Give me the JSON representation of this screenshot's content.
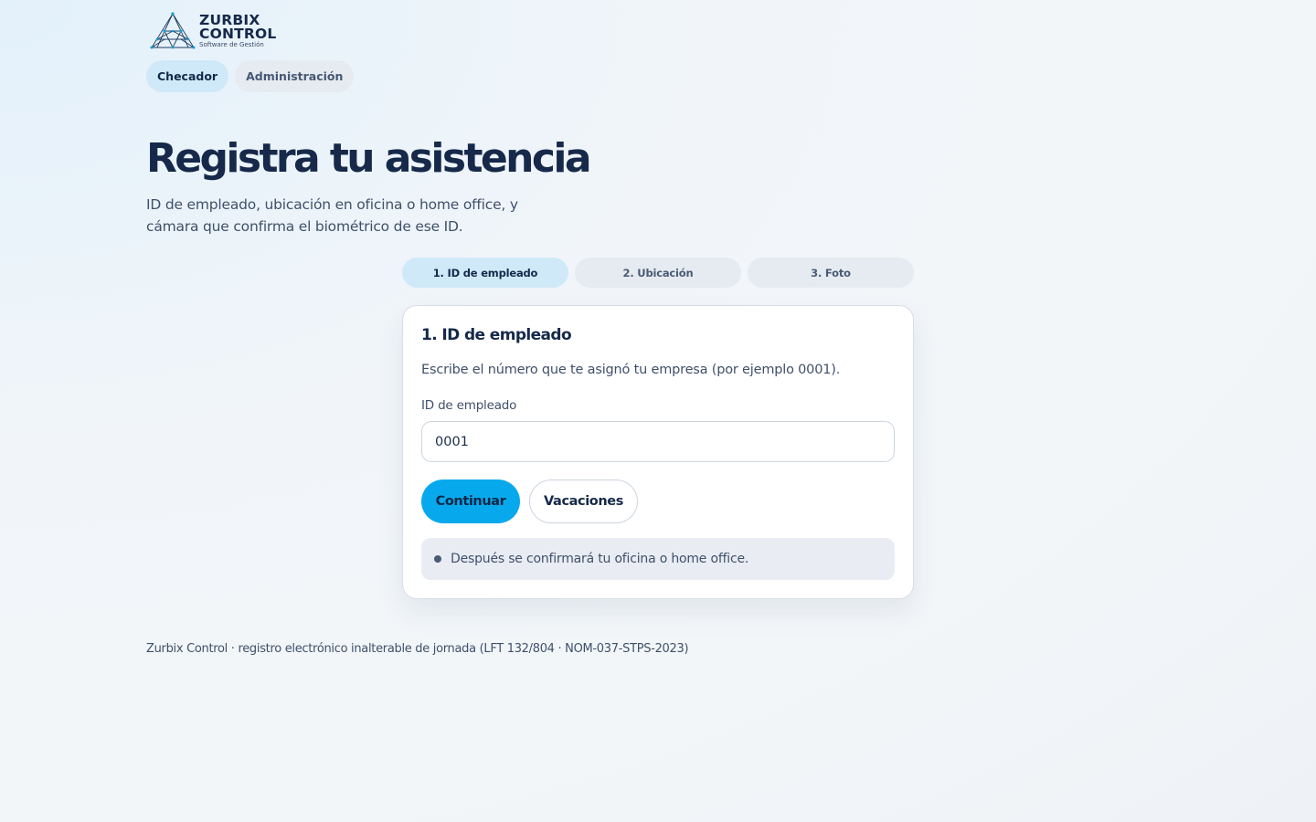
{
  "brand": {
    "name_line1": "ZURBIX",
    "name_line2": "CONTROL",
    "tagline": "Software de Gestión",
    "logo_icon": "network-pyramid-icon"
  },
  "nav": {
    "tabs": [
      {
        "label": "Checador",
        "active": true
      },
      {
        "label": "Administración",
        "active": false
      }
    ]
  },
  "hero": {
    "title": "Registra tu asistencia",
    "subtitle": "ID de empleado, ubicación en oficina o home office, y cámara que confirma el biométrico de ese ID."
  },
  "steps": [
    {
      "label": "1. ID de empleado",
      "active": true
    },
    {
      "label": "2. Ubicación",
      "active": false
    },
    {
      "label": "3. Foto",
      "active": false
    }
  ],
  "card": {
    "title": "1. ID de empleado",
    "description": "Escribe el número que te asignó tu empresa (por ejemplo 0001).",
    "field_label": "ID de empleado",
    "field_value": "0001",
    "continue_label": "Continuar",
    "vacations_label": "Vacaciones",
    "note": "Después se confirmará tu oficina o home office."
  },
  "footer": {
    "text": "Zurbix Control · registro electrónico inalterable de jornada (LFT 132/804 · NOM-037-STPS-2023)"
  },
  "colors": {
    "primary": "#08a9ec",
    "navy": "#16294a",
    "active_tab": "#cfe9f8",
    "inactive_tab": "#e6ebf1"
  }
}
